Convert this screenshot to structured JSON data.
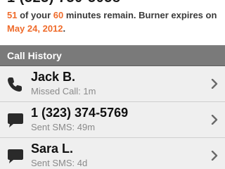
{
  "header": {
    "phone_number": "1 (323) 730-5058"
  },
  "status": {
    "minutes_used": "51",
    "text_of_your": " of your ",
    "minutes_total": "60",
    "text_remain": " minutes remain. Burner expires on ",
    "expiry_date": "May 24, 2012",
    "text_end": "."
  },
  "call_history": {
    "header_label": "Call History",
    "items": [
      {
        "title": "Jack B.",
        "subtitle": "Missed Call: 1m",
        "icon": "phone-icon"
      },
      {
        "title": "1 (323) 374-5769",
        "subtitle": "Sent SMS: 49m",
        "icon": "sms-bubble-icon"
      },
      {
        "title": "Sara L.",
        "subtitle": "Sent SMS: 4d",
        "icon": "sms-bubble-icon"
      }
    ]
  },
  "colors": {
    "accent": "#ef6c2c",
    "header_bg": "#7a7a7a",
    "row_bg": "#efefef"
  }
}
